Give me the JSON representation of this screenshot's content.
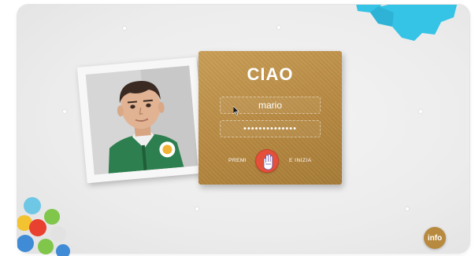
{
  "login_card": {
    "greeting": "CIAO",
    "username_value": "mario",
    "password_value": "••••••••••••••",
    "press_label": "PREMI",
    "enter_label": "E INIZIA",
    "hand_icon": "hand-icon"
  },
  "info_button": {
    "label": "info"
  },
  "colors": {
    "card": "#b78941",
    "button_red": "#e5503a",
    "info_gold": "#b88a3f",
    "gear_blue": "#35c3e6"
  }
}
